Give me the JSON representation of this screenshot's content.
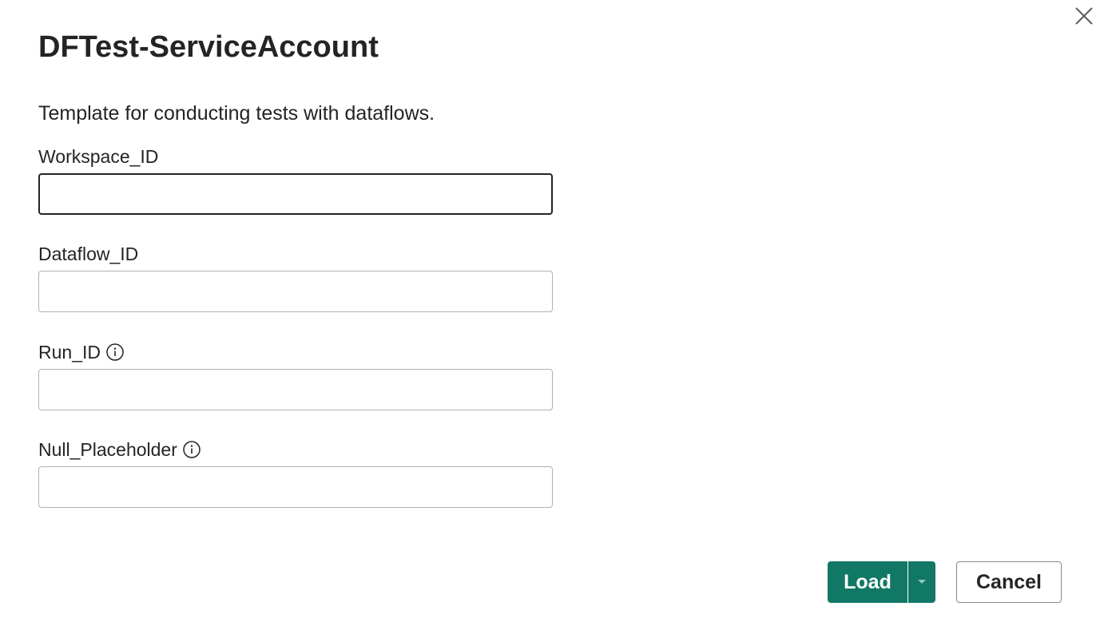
{
  "dialog": {
    "title": "DFTest-ServiceAccount",
    "description": "Template for conducting tests with dataflows.",
    "close_icon": "close-icon"
  },
  "fields": [
    {
      "label": "Workspace_ID",
      "value": "",
      "placeholder": "",
      "info": false,
      "focused": true
    },
    {
      "label": "Dataflow_ID",
      "value": "",
      "placeholder": "",
      "info": false,
      "focused": false
    },
    {
      "label": "Run_ID",
      "value": "",
      "placeholder": "",
      "info": true,
      "info_icon": "info-icon",
      "focused": false
    },
    {
      "label": "Null_Placeholder",
      "value": "",
      "placeholder": "",
      "info": true,
      "info_icon": "info-icon",
      "focused": false
    }
  ],
  "footer": {
    "load_label": "Load",
    "load_dropdown_icon": "caret-down-icon",
    "cancel_label": "Cancel"
  },
  "colors": {
    "primary": "#117865",
    "text": "#252423",
    "input_border": "#b3b0ad",
    "input_border_focused": "#252423",
    "secondary_border": "#8a8886"
  }
}
